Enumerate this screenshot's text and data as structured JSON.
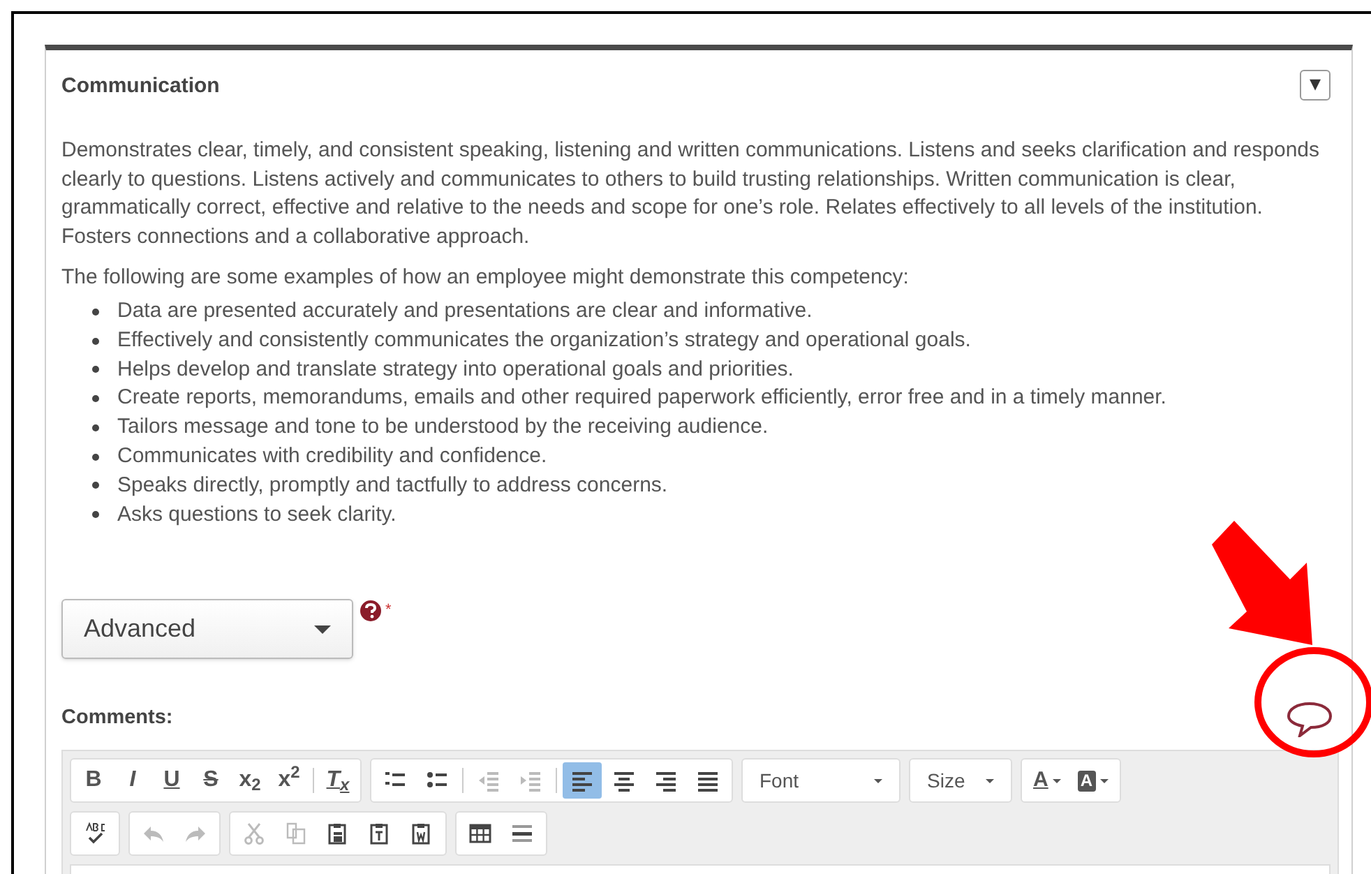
{
  "panel": {
    "title": "Communication",
    "collapse_button": "▾",
    "description": "Demonstrates clear, timely, and consistent speaking, listening and written communications. Listens and seeks clarification and responds clearly to questions. Listens actively and communicates to others to build trusting relationships. Written communication is clear, grammatically correct, effective and relative to the needs and scope for one’s role. Relates effectively to all levels of the institution. Fosters connections and a collaborative approach.",
    "intro": "The following are some examples of how an employee might demonstrate this competency:",
    "examples": [
      "Data are presented accurately and presentations are clear and informative.",
      "Effectively and consistently communicates the organization’s strategy and operational goals.",
      "Helps develop and translate strategy into operational goals and priorities.",
      "Create reports, memorandums, emails and other required paperwork efficiently, error free and in a timely manner.",
      "Tailors message and tone to be understood by the receiving audience.",
      "Communicates with credibility and confidence.",
      "Speaks directly, promptly and tactfully to address concerns.",
      "Asks questions to seek clarity."
    ],
    "rating": {
      "value": "Advanced",
      "required_mark": "*"
    },
    "comments_label": "Comments:"
  },
  "editor": {
    "toolbar_rows": [
      [
        {
          "kind": "group",
          "items": [
            {
              "kind": "glyph",
              "label": "B",
              "disabled": false,
              "selected": false
            },
            {
              "kind": "glyph",
              "label": "I",
              "disabled": false,
              "selected": false
            },
            {
              "kind": "glyph",
              "label": "U",
              "disabled": false,
              "selected": false
            },
            {
              "kind": "glyph",
              "label": "S",
              "disabled": false,
              "selected": false
            },
            {
              "kind": "glyph",
              "label": "x$_{2}$",
              "disabled": false,
              "selected": false
            },
            {
              "kind": "glyph",
              "label": "x$^{2}$",
              "disabled": false,
              "selected": false
            },
            {
              "kind": "separator"
            },
            {
              "kind": "glyph",
              "label": "T$_{x}$",
              "disabled": false,
              "selected": false
            }
          ]
        },
        {
          "kind": "group",
          "items": [
            {
              "kind": "icon",
              "disabled": false,
              "selected": false
            },
            {
              "kind": "icon",
              "disabled": false,
              "selected": false
            },
            {
              "kind": "separator"
            },
            {
              "kind": "icon",
              "disabled": true,
              "selected": false
            },
            {
              "kind": "icon",
              "disabled": true,
              "selected": false
            },
            {
              "kind": "separator"
            },
            {
              "kind": "icon",
              "disabled": false,
              "selected": true
            },
            {
              "kind": "icon",
              "disabled": false,
              "selected": false
            },
            {
              "kind": "icon",
              "disabled": false,
              "selected": false
            },
            {
              "kind": "icon",
              "disabled": false,
              "selected": false
            }
          ]
        },
        {
          "kind": "combo",
          "label": "Font"
        },
        {
          "kind": "combo",
          "label": "Size"
        },
        {
          "kind": "group",
          "items": [
            {
              "kind": "textcolor",
              "label": "A"
            },
            {
              "kind": "bgcolor",
              "label": "A"
            }
          ]
        }
      ],
      [
        {
          "kind": "group",
          "items": [
            {
              "kind": "icon",
              "disabled": false
            }
          ]
        },
        {
          "kind": "group",
          "items": [
            {
              "kind": "icon",
              "disabled": true,
              "selected": false
            },
            {
              "kind": "icon",
              "disabled": true,
              "selected": false
            }
          ]
        },
        {
          "kind": "group",
          "items": [
            {
              "kind": "icon",
              "disabled": true,
              "selected": false
            },
            {
              "kind": "icon",
              "disabled": true,
              "selected": false
            },
            {
              "kind": "icon",
              "disabled": false,
              "selected": false
            },
            {
              "kind": "icon",
              "disabled": false,
              "selected": false
            },
            {
              "kind": "icon",
              "disabled": false,
              "selected": false
            }
          ]
        },
        {
          "kind": "group",
          "items": [
            {
              "kind": "icon",
              "disabled": false,
              "selected": false
            },
            {
              "kind": "icon",
              "disabled": false,
              "selected": false
            }
          ]
        }
      ]
    ]
  }
}
